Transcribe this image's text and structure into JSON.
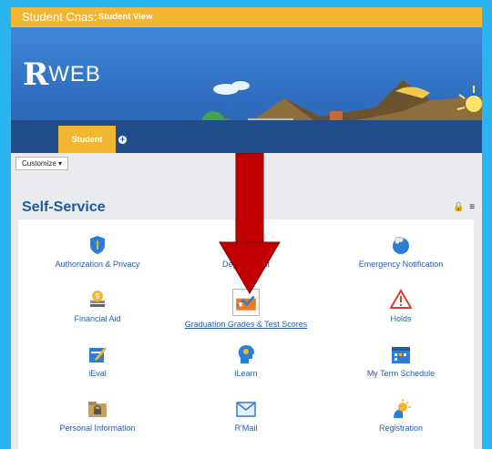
{
  "top_bar": {
    "title": "Student Cnas:",
    "view": "Student View"
  },
  "brand": {
    "logo_r": "R",
    "logo_web": "WEB"
  },
  "tabs": [
    {
      "label": "Student"
    }
  ],
  "customize": {
    "label": "Customize ▾"
  },
  "self_service": {
    "title": "Self-Service",
    "tiles": [
      {
        "label": "Authorization & Privacy",
        "icon": "shield-icon"
      },
      {
        "label": "Degree Audit",
        "icon": "degree-audit-icon"
      },
      {
        "label": "Emergency Notification",
        "icon": "emergency-phone-icon"
      },
      {
        "label": "Financial Aid",
        "icon": "money-icon"
      },
      {
        "label": "Graduation Grades & Test Scores",
        "icon": "grades-icon"
      },
      {
        "label": "Holds",
        "icon": "warning-icon"
      },
      {
        "label": "iEval",
        "icon": "evaluation-icon"
      },
      {
        "label": "iLearn",
        "icon": "ilearn-head-icon"
      },
      {
        "label": "My Term Schedule",
        "icon": "calendar-icon"
      },
      {
        "label": "Personal Information",
        "icon": "lock-file-icon"
      },
      {
        "label": "R'Mail",
        "icon": "mail-icon"
      },
      {
        "label": "Registration",
        "icon": "registration-sun-icon"
      }
    ]
  },
  "colors": {
    "accent": "#f2b632",
    "link": "#2a5ea8",
    "arrow": "#c00000",
    "frame": "#2ab4f0"
  }
}
